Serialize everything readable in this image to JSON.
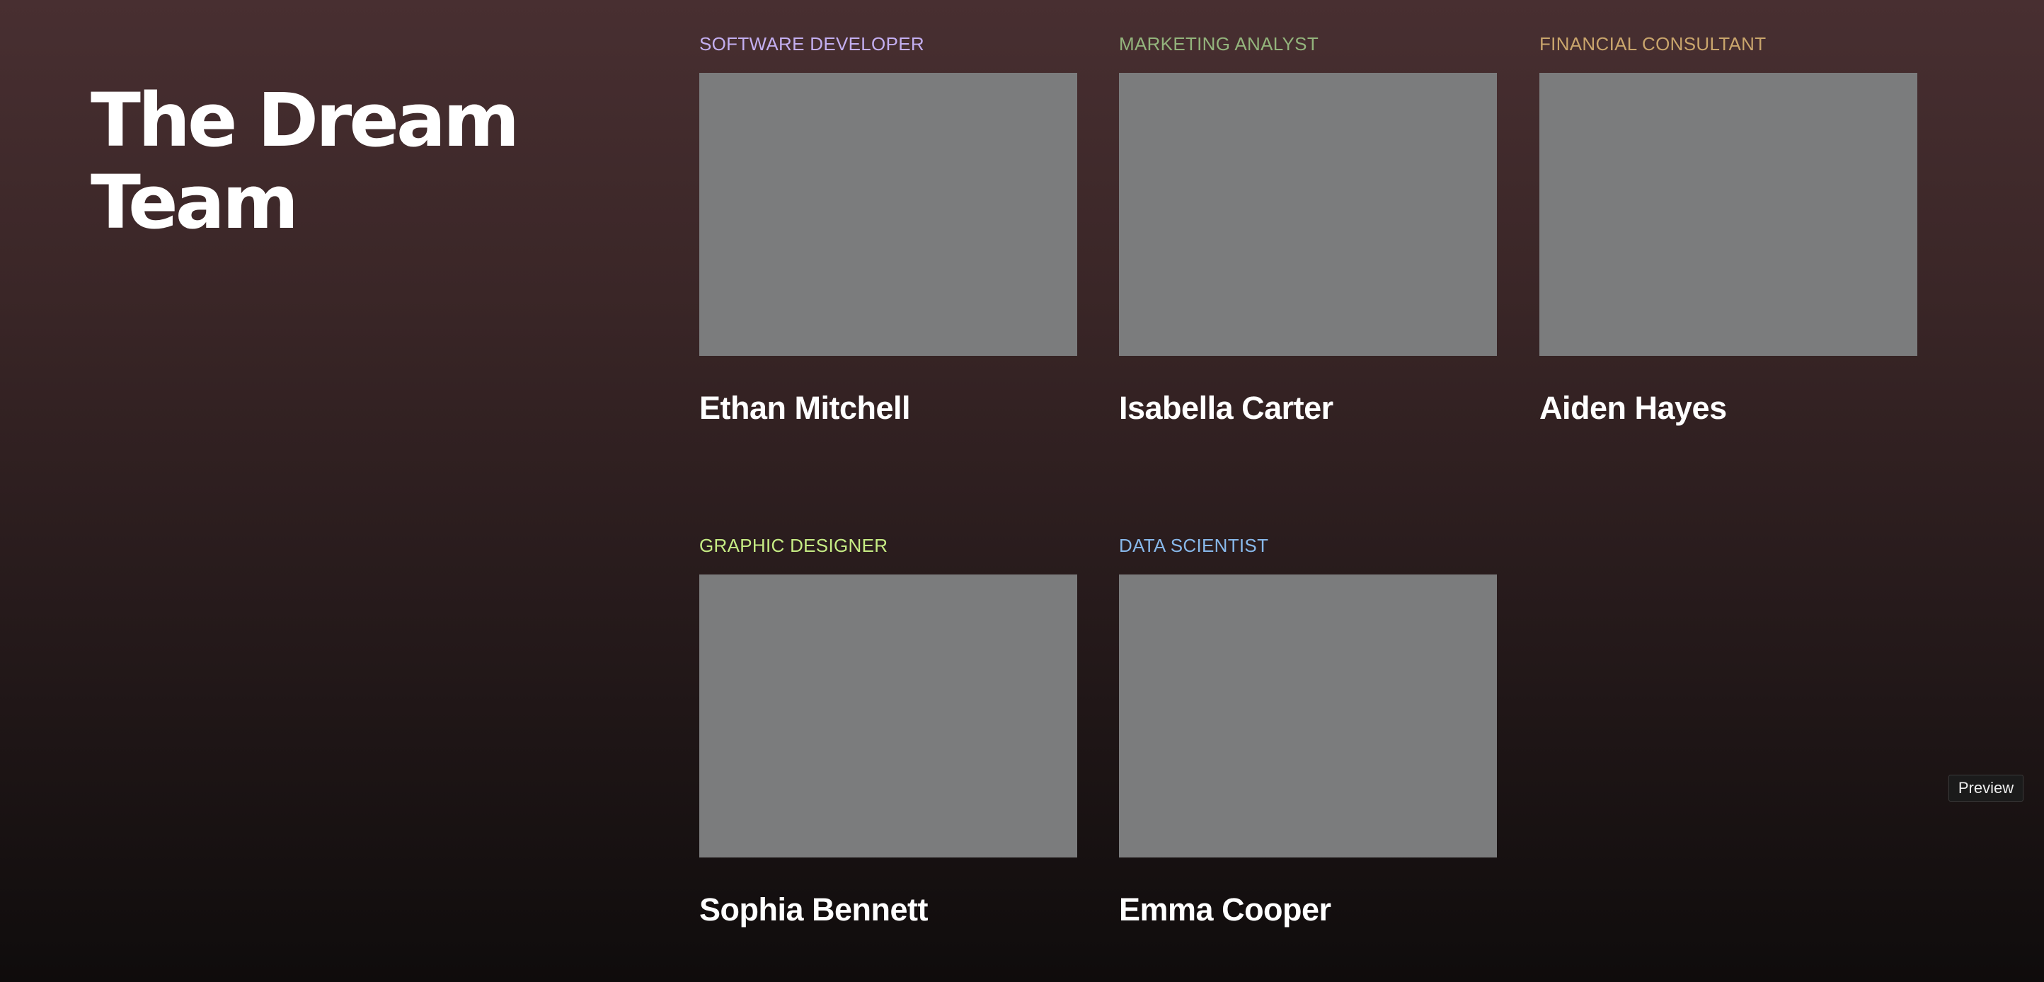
{
  "page": {
    "title": "The Dream Team"
  },
  "members": [
    {
      "role": "SOFTWARE DEVELOPER",
      "role_color": "#c3aef0",
      "name": "Ethan Mitchell"
    },
    {
      "role": "MARKETING ANALYST",
      "role_color": "#93b47c",
      "name": "Isabella Carter"
    },
    {
      "role": "FINANCIAL CONSULTANT",
      "role_color": "#c9a56c",
      "name": "Aiden Hayes"
    },
    {
      "role": "GRAPHIC DESIGNER",
      "role_color": "#c6ec84",
      "name": "Sophia Bennett"
    },
    {
      "role": "DATA SCIENTIST",
      "role_color": "#88b8ea",
      "name": "Emma Cooper"
    }
  ],
  "preview": {
    "label": "Preview"
  }
}
